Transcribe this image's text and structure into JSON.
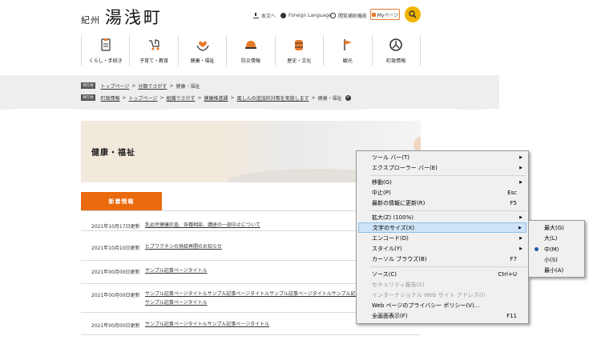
{
  "header": {
    "logo_small": "紀州",
    "logo_big": "湯浅町",
    "util_main": "本文へ",
    "util_language": "Foreign Language",
    "util_assist": "閲覧補助機能",
    "mypage": "Myページ"
  },
  "nav": [
    {
      "label": "くらし・手続き",
      "icon": "clipboard-icon"
    },
    {
      "label": "子育て・教育",
      "icon": "stroller-icon"
    },
    {
      "label": "健康・福祉",
      "icon": "heart-hands-icon"
    },
    {
      "label": "防災情報",
      "icon": "helmet-icon"
    },
    {
      "label": "歴史・文化",
      "icon": "barrel-icon"
    },
    {
      "label": "観光",
      "icon": "flag-icon"
    },
    {
      "label": "町政情報",
      "icon": "emblem-icon"
    }
  ],
  "breadcrumb": {
    "row1": {
      "tag": "現在地",
      "items": [
        "トップページ",
        "分類でさがす",
        "健康・福祉"
      ]
    },
    "row2": {
      "tag": "現在地",
      "items": [
        "町政情報",
        "トップページ",
        "組織でさがす",
        "健康推進課",
        "風しんの追加的対策を実施します",
        "健康・福祉"
      ]
    }
  },
  "hero": {
    "title": "健康・福祉"
  },
  "news": {
    "tab": "新着情報",
    "items": [
      {
        "date": "2021年10月17日更新",
        "title": "乳幼児健康診査、各種相談、講座の一部中止について"
      },
      {
        "date": "2021年10月10日更新",
        "title": "ヒブワクチンの供給再開のお知らせ"
      },
      {
        "date": "2021年00月00日更新",
        "title": "サンプル記事ページタイトル"
      },
      {
        "date": "2021年00月00日更新",
        "title": "サンプル記事ページタイトルサンプル記事ページタイトルサンプル記事ページタイトルサンプル記事ページタイトル",
        "title2": "サンプル記事ページタイトル"
      },
      {
        "date": "2021年00月00日更新",
        "title": "サンプル記事ページタイトルサンプル記事ページタイトル"
      }
    ]
  },
  "context_menu": {
    "items": [
      {
        "label": "ツール バー(T)",
        "shortcut": "",
        "submenu": true
      },
      {
        "label": "エクスプローラー バー(E)",
        "shortcut": "",
        "submenu": true
      },
      {
        "label": "移動(G)",
        "shortcut": "",
        "submenu": true
      },
      {
        "label": "中止(P)",
        "shortcut": "Esc"
      },
      {
        "label": "最新の情報に更新(R)",
        "shortcut": "F5"
      },
      {
        "label": "拡大(Z) (100%)",
        "shortcut": "",
        "submenu": true
      },
      {
        "label": "文字のサイズ(X)",
        "shortcut": "",
        "submenu": true,
        "active": true
      },
      {
        "label": "エンコード(D)",
        "shortcut": "",
        "submenu": true
      },
      {
        "label": "スタイル(Y)",
        "shortcut": "",
        "submenu": true
      },
      {
        "label": "カーソル ブラウズ(B)",
        "shortcut": "F7"
      },
      {
        "label": "ソース(C)",
        "shortcut": "Ctrl+U"
      },
      {
        "label": "セキュリティ報告(S)",
        "shortcut": "",
        "disabled": true
      },
      {
        "label": "インターナショナル Web サイト アドレス(I)",
        "shortcut": "",
        "disabled": true
      },
      {
        "label": "Web ページのプライバシー ポリシー(V)...",
        "shortcut": ""
      },
      {
        "label": "全画面表示(F)",
        "shortcut": "F11"
      }
    ]
  },
  "text_size_menu": {
    "items": [
      "最大(G)",
      "大(L)",
      "中(M)",
      "小(S)",
      "最小(A)"
    ],
    "selected_index": 2
  },
  "colors": {
    "accent_orange": "#ea6a0e",
    "search_yellow": "#f0b400",
    "menu_highlight": "#cde3f7"
  }
}
